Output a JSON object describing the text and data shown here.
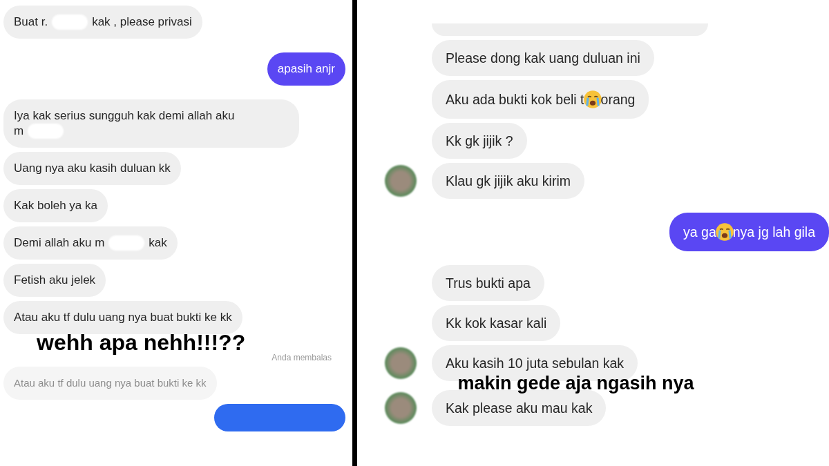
{
  "panels": [
    {
      "kind": "narrow",
      "messages": [
        {
          "kind": "received",
          "parts": [
            {
              "text": "Buat r."
            },
            {
              "kind": "redacted"
            },
            {
              "text": "kak , please privasi"
            }
          ]
        },
        {
          "kind": "sent",
          "parts": [
            {
              "text": "apasih anjr"
            }
          ]
        },
        {
          "kind": "received",
          "parts": [
            {
              "text": "Iya kak serius sungguh kak demi allah aku"
            },
            {
              "kind": "break"
            },
            {
              "text": "m"
            },
            {
              "kind": "redacted"
            }
          ]
        },
        {
          "kind": "received",
          "parts": [
            {
              "text": "Uang nya aku kasih duluan kk"
            }
          ]
        },
        {
          "kind": "received",
          "parts": [
            {
              "text": "Kak boleh ya ka"
            }
          ]
        },
        {
          "kind": "received",
          "parts": [
            {
              "text": "Demi allah aku m"
            },
            {
              "kind": "redacted"
            },
            {
              "text": "kak"
            }
          ]
        },
        {
          "kind": "received",
          "parts": [
            {
              "text": "Fetish aku jelek"
            }
          ]
        },
        {
          "kind": "received",
          "parts": [
            {
              "text": "Atau aku tf dulu uang nya buat bukti ke kk"
            }
          ]
        },
        {
          "kind": "caption",
          "parts": [
            {
              "text": "wehh apa nehh!!!??"
            }
          ]
        },
        {
          "kind": "note",
          "parts": [
            {
              "text": "Anda membalas"
            }
          ]
        },
        {
          "kind": "quote",
          "parts": [
            {
              "text": "Atau aku tf dulu uang nya buat bukti ke kk"
            }
          ]
        },
        {
          "kind": "sent_cut"
        }
      ]
    },
    {
      "kind": "wide",
      "messages": [
        {
          "kind": "received_cut"
        },
        {
          "kind": "received",
          "avatar": false,
          "parts": [
            {
              "text": "Please dong kak uang duluan ini"
            }
          ]
        },
        {
          "kind": "received",
          "avatar": false,
          "parts": [
            {
              "text": "Aku ada bukti kok beli t"
            },
            {
              "kind": "emoji"
            },
            {
              "text": "orang"
            }
          ]
        },
        {
          "kind": "received",
          "avatar": false,
          "parts": [
            {
              "text": "Kk gk jijik ?"
            }
          ]
        },
        {
          "kind": "received",
          "avatar": true,
          "parts": [
            {
              "text": "Klau gk jijik aku kirim"
            }
          ]
        },
        {
          "kind": "sent",
          "parts": [
            {
              "text": "ya ga"
            },
            {
              "kind": "emoji"
            },
            {
              "text": "nya jg lah gila"
            }
          ]
        },
        {
          "kind": "received",
          "avatar": false,
          "parts": [
            {
              "text": "Trus bukti apa"
            }
          ]
        },
        {
          "kind": "received",
          "avatar": false,
          "parts": [
            {
              "text": "Kk kok kasar kali"
            }
          ]
        },
        {
          "kind": "received",
          "avatar": true,
          "parts": [
            {
              "text": "Aku kasih 10 juta sebulan kak"
            }
          ]
        },
        {
          "kind": "caption",
          "parts": [
            {
              "text": "makin gede aja ngasih nya"
            }
          ]
        },
        {
          "kind": "received",
          "avatar": true,
          "parts": [
            {
              "text": "Kak please aku mau kak"
            }
          ]
        }
      ]
    }
  ]
}
